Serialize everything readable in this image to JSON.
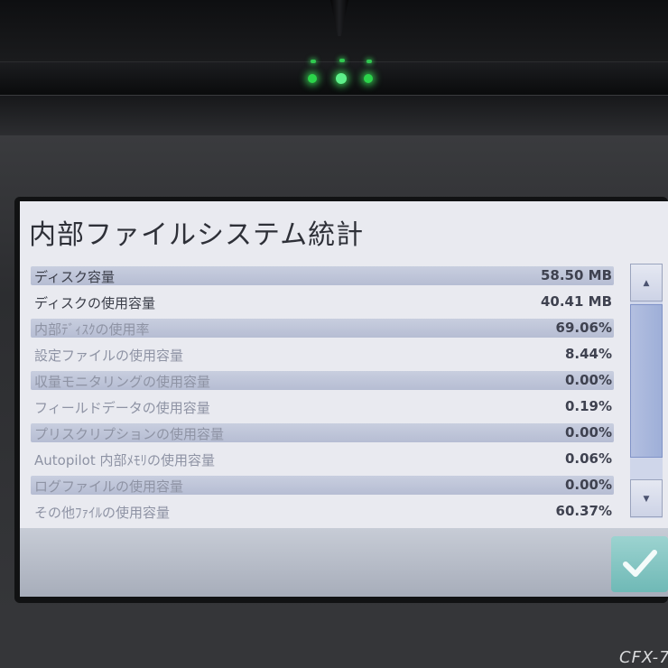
{
  "title": "内部ファイルシステム統計",
  "rows": [
    {
      "label": "ディスク容量",
      "value": "58.50 MB"
    },
    {
      "label": "ディスクの使用容量",
      "value": "40.41 MB"
    },
    {
      "label": "内部ﾃﾞｨｽｸの使用率",
      "value": "69.06%"
    },
    {
      "label": "設定ファイルの使用容量",
      "value": "8.44%"
    },
    {
      "label": "収量モニタリングの使用容量",
      "value": "0.00%"
    },
    {
      "label": "フィールドデータの使用容量",
      "value": "0.19%"
    },
    {
      "label": "プリスクリプションの使用容量",
      "value": "0.00%"
    },
    {
      "label": "Autopilot 内部ﾒﾓﾘの使用容量",
      "value": "0.06%"
    },
    {
      "label": "ログファイルの使用容量",
      "value": "0.00%"
    },
    {
      "label": "その他ﾌｧｲﾙの使用容量",
      "value": "60.37%"
    }
  ],
  "scroll": {
    "up_glyph": "▲",
    "down_glyph": "▼"
  },
  "ok_button": {
    "icon": "check-icon",
    "color": "#7cc4c1"
  },
  "device_brand": "CFX-7"
}
